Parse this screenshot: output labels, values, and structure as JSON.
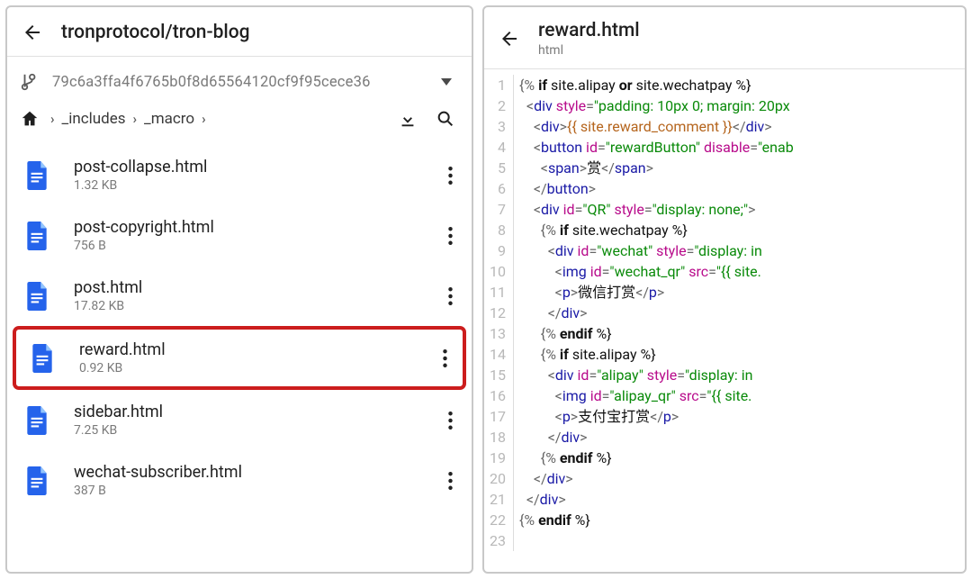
{
  "left": {
    "title": "tronprotocol/tron-blog",
    "commit": "79c6a3ffa4f6765b0f8d65564120cf9f95cece36",
    "breadcrumbs": [
      "_includes",
      "_macro"
    ],
    "files": [
      {
        "name": "post-collapse.html",
        "size": "1.32 KB",
        "highlight": false
      },
      {
        "name": "post-copyright.html",
        "size": "756 B",
        "highlight": false
      },
      {
        "name": "post.html",
        "size": "17.82 KB",
        "highlight": false
      },
      {
        "name": "reward.html",
        "size": "0.92 KB",
        "highlight": true
      },
      {
        "name": "sidebar.html",
        "size": "7.25 KB",
        "highlight": false
      },
      {
        "name": "wechat-subscriber.html",
        "size": "387 B",
        "highlight": false
      }
    ]
  },
  "right": {
    "title": "reward.html",
    "subtitle": "html",
    "lines": [
      {
        "n": 1,
        "i": 0,
        "seg": [
          [
            "delim",
            "{% "
          ],
          [
            "kw",
            "if"
          ],
          [
            "txt",
            " site.alipay "
          ],
          [
            "kw",
            "or"
          ],
          [
            "txt",
            " site.wechatpay %}"
          ]
        ]
      },
      {
        "n": 2,
        "i": 1,
        "seg": [
          [
            "delim",
            "<"
          ],
          [
            "tag",
            "div"
          ],
          [
            "txt",
            " "
          ],
          [
            "attr",
            "style"
          ],
          [
            "delim",
            "="
          ],
          [
            "str",
            "\"padding: 10px 0; margin: 20px"
          ]
        ]
      },
      {
        "n": 3,
        "i": 2,
        "seg": [
          [
            "delim",
            "<"
          ],
          [
            "tag",
            "div"
          ],
          [
            "delim",
            ">"
          ],
          [
            "var",
            "{{ site.reward_comment }}"
          ],
          [
            "delim",
            "</"
          ],
          [
            "tag",
            "div"
          ],
          [
            "delim",
            ">"
          ]
        ]
      },
      {
        "n": 4,
        "i": 2,
        "seg": [
          [
            "delim",
            "<"
          ],
          [
            "tag",
            "button"
          ],
          [
            "txt",
            " "
          ],
          [
            "attr",
            "id"
          ],
          [
            "delim",
            "="
          ],
          [
            "str",
            "\"rewardButton\""
          ],
          [
            "txt",
            " "
          ],
          [
            "attr",
            "disable"
          ],
          [
            "delim",
            "="
          ],
          [
            "str",
            "\"enab"
          ]
        ]
      },
      {
        "n": 5,
        "i": 3,
        "seg": [
          [
            "delim",
            "<"
          ],
          [
            "tag",
            "span"
          ],
          [
            "delim",
            ">"
          ],
          [
            "txt",
            "赏"
          ],
          [
            "delim",
            "</"
          ],
          [
            "tag",
            "span"
          ],
          [
            "delim",
            ">"
          ]
        ]
      },
      {
        "n": 6,
        "i": 2,
        "seg": [
          [
            "delim",
            "</"
          ],
          [
            "tag",
            "button"
          ],
          [
            "delim",
            ">"
          ]
        ]
      },
      {
        "n": 7,
        "i": 2,
        "seg": [
          [
            "delim",
            "<"
          ],
          [
            "tag",
            "div"
          ],
          [
            "txt",
            " "
          ],
          [
            "attr",
            "id"
          ],
          [
            "delim",
            "="
          ],
          [
            "str",
            "\"QR\""
          ],
          [
            "txt",
            " "
          ],
          [
            "attr",
            "style"
          ],
          [
            "delim",
            "="
          ],
          [
            "str",
            "\"display: none;\""
          ],
          [
            "delim",
            ">"
          ]
        ]
      },
      {
        "n": 8,
        "i": 3,
        "seg": [
          [
            "delim",
            "{% "
          ],
          [
            "kw",
            "if"
          ],
          [
            "txt",
            " site.wechatpay %}"
          ]
        ]
      },
      {
        "n": 9,
        "i": 4,
        "seg": [
          [
            "delim",
            "<"
          ],
          [
            "tag",
            "div"
          ],
          [
            "txt",
            " "
          ],
          [
            "attr",
            "id"
          ],
          [
            "delim",
            "="
          ],
          [
            "str",
            "\"wechat\""
          ],
          [
            "txt",
            " "
          ],
          [
            "attr",
            "style"
          ],
          [
            "delim",
            "="
          ],
          [
            "str",
            "\"display: in"
          ]
        ]
      },
      {
        "n": 10,
        "i": 5,
        "seg": [
          [
            "delim",
            "<"
          ],
          [
            "tag",
            "img"
          ],
          [
            "txt",
            " "
          ],
          [
            "attr",
            "id"
          ],
          [
            "delim",
            "="
          ],
          [
            "str",
            "\"wechat_qr\""
          ],
          [
            "txt",
            " "
          ],
          [
            "attr",
            "src"
          ],
          [
            "delim",
            "="
          ],
          [
            "str",
            "\"{{ site."
          ]
        ]
      },
      {
        "n": 11,
        "i": 5,
        "seg": [
          [
            "delim",
            "<"
          ],
          [
            "tag",
            "p"
          ],
          [
            "delim",
            ">"
          ],
          [
            "txt",
            "微信打赏"
          ],
          [
            "delim",
            "</"
          ],
          [
            "tag",
            "p"
          ],
          [
            "delim",
            ">"
          ]
        ]
      },
      {
        "n": 12,
        "i": 4,
        "seg": [
          [
            "delim",
            "</"
          ],
          [
            "tag",
            "div"
          ],
          [
            "delim",
            ">"
          ]
        ]
      },
      {
        "n": 13,
        "i": 3,
        "seg": [
          [
            "delim",
            "{% "
          ],
          [
            "kw",
            "endif"
          ],
          [
            "txt",
            " %}"
          ]
        ]
      },
      {
        "n": 14,
        "i": 3,
        "seg": [
          [
            "delim",
            "{% "
          ],
          [
            "kw",
            "if"
          ],
          [
            "txt",
            " site.alipay %}"
          ]
        ]
      },
      {
        "n": 15,
        "i": 4,
        "seg": [
          [
            "delim",
            "<"
          ],
          [
            "tag",
            "div"
          ],
          [
            "txt",
            " "
          ],
          [
            "attr",
            "id"
          ],
          [
            "delim",
            "="
          ],
          [
            "str",
            "\"alipay\""
          ],
          [
            "txt",
            " "
          ],
          [
            "attr",
            "style"
          ],
          [
            "delim",
            "="
          ],
          [
            "str",
            "\"display: in"
          ]
        ]
      },
      {
        "n": 16,
        "i": 5,
        "seg": [
          [
            "delim",
            "<"
          ],
          [
            "tag",
            "img"
          ],
          [
            "txt",
            " "
          ],
          [
            "attr",
            "id"
          ],
          [
            "delim",
            "="
          ],
          [
            "str",
            "\"alipay_qr\""
          ],
          [
            "txt",
            " "
          ],
          [
            "attr",
            "src"
          ],
          [
            "delim",
            "="
          ],
          [
            "str",
            "\"{{ site."
          ]
        ]
      },
      {
        "n": 17,
        "i": 5,
        "seg": [
          [
            "delim",
            "<"
          ],
          [
            "tag",
            "p"
          ],
          [
            "delim",
            ">"
          ],
          [
            "txt",
            "支付宝打赏"
          ],
          [
            "delim",
            "</"
          ],
          [
            "tag",
            "p"
          ],
          [
            "delim",
            ">"
          ]
        ]
      },
      {
        "n": 18,
        "i": 4,
        "seg": [
          [
            "delim",
            "</"
          ],
          [
            "tag",
            "div"
          ],
          [
            "delim",
            ">"
          ]
        ]
      },
      {
        "n": 19,
        "i": 3,
        "seg": [
          [
            "delim",
            "{% "
          ],
          [
            "kw",
            "endif"
          ],
          [
            "txt",
            " %}"
          ]
        ]
      },
      {
        "n": 20,
        "i": 2,
        "seg": [
          [
            "delim",
            "</"
          ],
          [
            "tag",
            "div"
          ],
          [
            "delim",
            ">"
          ]
        ]
      },
      {
        "n": 21,
        "i": 1,
        "seg": [
          [
            "delim",
            "</"
          ],
          [
            "tag",
            "div"
          ],
          [
            "delim",
            ">"
          ]
        ]
      },
      {
        "n": 22,
        "i": 0,
        "seg": [
          [
            "delim",
            "{% "
          ],
          [
            "kw",
            "endif"
          ],
          [
            "txt",
            " %}"
          ]
        ]
      },
      {
        "n": 23,
        "i": 0,
        "seg": []
      }
    ]
  }
}
